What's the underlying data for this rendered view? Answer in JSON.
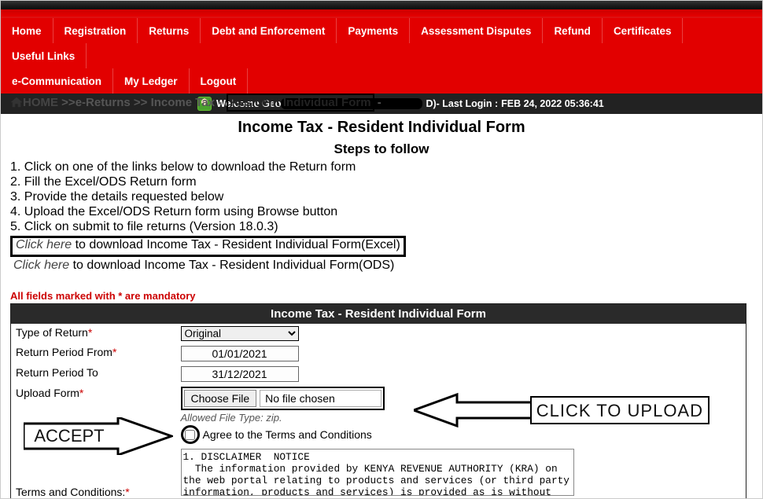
{
  "nav": {
    "row1": [
      "Home",
      "Registration",
      "Returns",
      "Debt and Enforcement",
      "Payments",
      "Assessment Disputes",
      "Refund",
      "Certificates",
      "Useful Links"
    ],
    "row2": [
      "e-Communication",
      "My Ledger",
      "Logout"
    ]
  },
  "userbar": {
    "welcome_prefix": "Welcome Geo",
    "suffix_initial": "D)",
    "last_login_label": " - Last Login :",
    "last_login_value": "FEB 24, 2022 05:36:41"
  },
  "breadcrumb": {
    "home": "HOME",
    "sep": ">>",
    "l1": "e-Returns",
    "l2": "Income Tax",
    "l3": "Resident Individual Form"
  },
  "page": {
    "title": "Income Tax - Resident Individual Form",
    "steps_title": "Steps to follow"
  },
  "steps": {
    "s1": "1. Click on one of the links below to download the Return form",
    "s2": "2. Fill the Excel/ODS Return form",
    "s3": "3. Provide the details requested below",
    "s4": "4. Upload the Excel/ODS Return form using Browse button",
    "s5": "5. Click on submit to file returns (Version 18.0.3)"
  },
  "downloads": {
    "click_here": "Click here",
    "excel_rest": " to download Income Tax - Resident Individual Form(Excel)",
    "ods_rest": " to download Income Tax - Resident Individual Form(ODS)"
  },
  "mandatory_note": "All fields marked with * are mandatory",
  "form": {
    "header": "Income Tax - Resident Individual Form",
    "type_label": "Type of Return",
    "type_value": "Original",
    "period_from_label": "Return Period From",
    "period_from_value": "01/01/2021",
    "period_to_label": "Return Period To",
    "period_to_value": "31/12/2021",
    "upload_label": "Upload Form",
    "choose_btn": "Choose File",
    "nofile": "No file chosen",
    "allowed": "Allowed File Type: zip.",
    "agree_label": "Agree to the Terms and Conditions",
    "terms_label": "Terms and Conditions:",
    "terms_text": "1. DISCLAIMER  NOTICE\n  The information provided by KENYA REVENUE AUTHORITY (KRA) on the web portal relating to products and services (or third party information, products and services) is provided as is without any"
  },
  "annotations": {
    "upload": "CLICK TO UPLOAD",
    "accept": "ACCEPT"
  }
}
